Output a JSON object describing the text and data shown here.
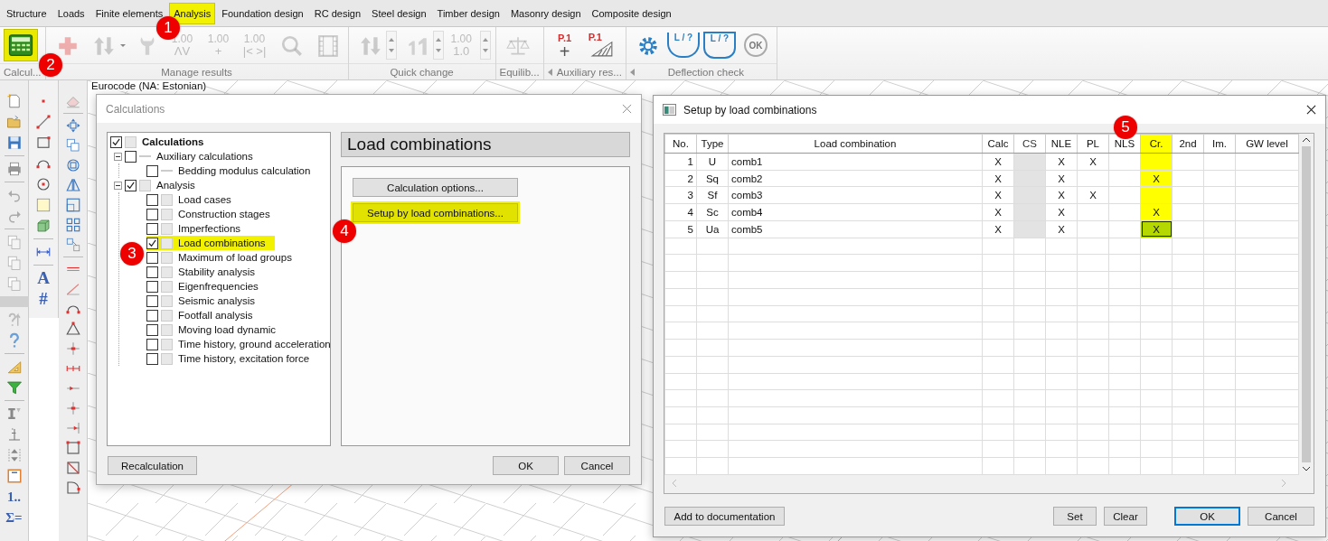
{
  "menu": [
    {
      "label": "Structure",
      "selected": false
    },
    {
      "label": "Loads",
      "selected": false
    },
    {
      "label": "Finite elements",
      "selected": false
    },
    {
      "label": "Analysis",
      "selected": true
    },
    {
      "label": "Foundation design",
      "selected": false
    },
    {
      "label": "RC design",
      "selected": false
    },
    {
      "label": "Steel design",
      "selected": false
    },
    {
      "label": "Timber design",
      "selected": false
    },
    {
      "label": "Masonry design",
      "selected": false
    },
    {
      "label": "Composite design",
      "selected": false
    }
  ],
  "ribbon": {
    "groups": [
      {
        "label": "Calcul...",
        "launcher": false,
        "items": [
          {
            "kind": "calculator",
            "disabled": false,
            "highlighted": true,
            "dropdown": false,
            "spinner": false
          }
        ]
      },
      {
        "label": "Manage results",
        "launcher": false,
        "items": [
          {
            "kind": "plus",
            "disabled": true,
            "highlighted": false,
            "dropdown": false,
            "spinner": false
          },
          {
            "kind": "arrows",
            "disabled": true,
            "highlighted": false,
            "dropdown": true,
            "spinner": false
          },
          {
            "kind": "wrench",
            "disabled": true,
            "highlighted": false,
            "dropdown": false,
            "spinner": false
          },
          {
            "kind": "text-stack",
            "lines": [
              "1.00",
              "ΛV"
            ],
            "disabled": true,
            "highlighted": false,
            "dropdown": false,
            "spinner": false
          },
          {
            "kind": "text-stack",
            "lines": [
              "1.00",
              "+"
            ],
            "disabled": true,
            "highlighted": false,
            "dropdown": false,
            "spinner": false
          },
          {
            "kind": "text-stack",
            "lines": [
              "1.00",
              "|< >|"
            ],
            "disabled": true,
            "highlighted": false,
            "dropdown": false,
            "spinner": false
          },
          {
            "kind": "magnifier",
            "disabled": true,
            "highlighted": false,
            "dropdown": false,
            "spinner": false
          },
          {
            "kind": "film",
            "disabled": true,
            "highlighted": false,
            "dropdown": false,
            "spinner": false
          }
        ]
      },
      {
        "label": "Quick change",
        "launcher": false,
        "items": [
          {
            "kind": "arrows",
            "disabled": true,
            "highlighted": false,
            "dropdown": false,
            "spinner": true
          },
          {
            "kind": "ones",
            "disabled": true,
            "highlighted": false,
            "dropdown": false,
            "spinner": true
          },
          {
            "kind": "text-stack",
            "lines": [
              "1.00",
              "1.0"
            ],
            "disabled": true,
            "highlighted": false,
            "dropdown": false,
            "spinner": true
          }
        ]
      },
      {
        "label": "Equilib...",
        "launcher": false,
        "items": [
          {
            "kind": "scales",
            "disabled": true,
            "highlighted": false,
            "dropdown": false,
            "spinner": false
          }
        ]
      },
      {
        "label": "Auxiliary res...",
        "launcher": true,
        "items": [
          {
            "kind": "point-load",
            "lines": [
              "P.1",
              "+"
            ],
            "disabled": false,
            "highlighted": false,
            "dropdown": false,
            "spinner": false
          },
          {
            "kind": "hatched-load",
            "lines": [
              "P.1"
            ],
            "disabled": false,
            "highlighted": false,
            "dropdown": false,
            "spinner": false
          }
        ]
      },
      {
        "label": "Deflection check",
        "launcher": true,
        "items": [
          {
            "kind": "gear",
            "disabled": false,
            "highlighted": false,
            "dropdown": false,
            "spinner": false
          },
          {
            "kind": "span",
            "lines": [
              "L / ?"
            ],
            "disabled": false,
            "highlighted": false,
            "dropdown": false,
            "spinner": false
          },
          {
            "kind": "span-box",
            "lines": [
              "L / ?"
            ],
            "disabled": false,
            "highlighted": false,
            "dropdown": false,
            "spinner": false
          },
          {
            "kind": "ok-circle",
            "lines": [
              "OK"
            ],
            "disabled": true,
            "highlighted": false,
            "dropdown": false,
            "spinner": false
          }
        ]
      }
    ]
  },
  "left_toolbars": [
    {
      "items": [
        {
          "kind": "new"
        },
        {
          "kind": "open"
        },
        {
          "kind": "save"
        },
        {
          "kind": "separator"
        },
        {
          "kind": "print"
        },
        {
          "kind": "separator"
        },
        {
          "kind": "undo"
        },
        {
          "kind": "redo"
        },
        {
          "kind": "separator"
        },
        {
          "kind": "copy"
        },
        {
          "kind": "copy"
        },
        {
          "kind": "copy"
        },
        {
          "kind": "gap"
        },
        {
          "kind": "help-arrow"
        },
        {
          "kind": "help"
        },
        {
          "kind": "separator"
        },
        {
          "kind": "set-square"
        },
        {
          "kind": "filter"
        },
        {
          "kind": "separator"
        },
        {
          "kind": "section"
        },
        {
          "kind": "height"
        },
        {
          "kind": "align"
        },
        {
          "kind": "frame"
        },
        {
          "kind": "glyph",
          "text": "1.."
        },
        {
          "kind": "glyph",
          "text": "Σ="
        }
      ]
    },
    {
      "items": [
        {
          "kind": "point"
        },
        {
          "kind": "line"
        },
        {
          "kind": "rect"
        },
        {
          "kind": "arc"
        },
        {
          "kind": "circle"
        },
        {
          "kind": "plate"
        },
        {
          "kind": "cube"
        },
        {
          "kind": "separator"
        },
        {
          "kind": "dimension"
        },
        {
          "kind": "separator"
        },
        {
          "kind": "glyph",
          "text": "A"
        },
        {
          "kind": "glyph",
          "text": "#"
        }
      ]
    },
    {
      "items": [
        {
          "kind": "eraser"
        },
        {
          "kind": "separator"
        },
        {
          "kind": "move"
        },
        {
          "kind": "copy-move"
        },
        {
          "kind": "rotate"
        },
        {
          "kind": "mirror"
        },
        {
          "kind": "scale"
        },
        {
          "kind": "array"
        },
        {
          "kind": "distribute"
        },
        {
          "kind": "separator"
        },
        {
          "kind": "hline"
        },
        {
          "kind": "slope"
        },
        {
          "kind": "arc"
        },
        {
          "kind": "triangle"
        },
        {
          "kind": "cross"
        },
        {
          "kind": "dimline"
        },
        {
          "kind": "arrow-point"
        },
        {
          "kind": "cross"
        },
        {
          "kind": "arrow-end"
        },
        {
          "kind": "rect-corners"
        },
        {
          "kind": "rect-diag"
        },
        {
          "kind": "rect-arc"
        }
      ]
    }
  ],
  "canvas": {
    "caption": "Eurocode (NA: Estonian)"
  },
  "calculations_dialog": {
    "title": "Calculations",
    "tree": [
      {
        "label": "Calculations",
        "checked": true,
        "selected": false,
        "kind": "box",
        "children": [
          {
            "label": "Auxiliary calculations",
            "checked": false,
            "selected": false,
            "kind": "dash",
            "expanded": true,
            "children": [
              {
                "label": "Bedding modulus calculation",
                "checked": false,
                "selected": false,
                "kind": "dash"
              }
            ]
          },
          {
            "label": "Analysis",
            "checked": true,
            "selected": false,
            "kind": "box",
            "expanded": true,
            "children": [
              {
                "label": "Load cases",
                "checked": false,
                "selected": false,
                "kind": "box"
              },
              {
                "label": "Construction stages",
                "checked": false,
                "selected": false,
                "kind": "box"
              },
              {
                "label": "Imperfections",
                "checked": false,
                "selected": false,
                "kind": "box"
              },
              {
                "label": "Load combinations",
                "checked": true,
                "selected": true,
                "kind": "box"
              },
              {
                "label": "Maximum of load groups",
                "checked": false,
                "selected": false,
                "kind": "box"
              },
              {
                "label": "Stability analysis",
                "checked": false,
                "selected": false,
                "kind": "box"
              },
              {
                "label": "Eigenfrequencies",
                "checked": false,
                "selected": false,
                "kind": "box"
              },
              {
                "label": "Seismic analysis",
                "checked": false,
                "selected": false,
                "kind": "box"
              },
              {
                "label": "Footfall analysis",
                "checked": false,
                "selected": false,
                "kind": "box"
              },
              {
                "label": "Moving load dynamic",
                "checked": false,
                "selected": false,
                "kind": "box"
              },
              {
                "label": "Time history, ground acceleration",
                "checked": false,
                "selected": false,
                "kind": "box"
              },
              {
                "label": "Time history, excitation force",
                "checked": false,
                "selected": false,
                "kind": "box"
              }
            ]
          }
        ]
      }
    ],
    "heading": "Load combinations",
    "panel_buttons": [
      {
        "label": "Calculation options...",
        "highlighted": false
      },
      {
        "label": "Setup by load combinations...",
        "highlighted": true
      }
    ],
    "buttons": [
      {
        "label": "Recalculation",
        "kind": "left"
      },
      {
        "label": "OK",
        "kind": "right"
      },
      {
        "label": "Cancel",
        "kind": "right"
      }
    ]
  },
  "setup_dialog": {
    "title": "Setup by load combinations",
    "columns": [
      {
        "label": "No.",
        "kind": "number",
        "disabled": false,
        "highlighted": false
      },
      {
        "label": "Type",
        "kind": "flag",
        "disabled": false,
        "highlighted": false
      },
      {
        "label": "Load combination",
        "kind": "text",
        "disabled": false,
        "highlighted": false
      },
      {
        "label": "Calc",
        "kind": "flag",
        "disabled": false,
        "highlighted": false
      },
      {
        "label": "CS",
        "kind": "flag",
        "disabled": true,
        "highlighted": false
      },
      {
        "label": "NLE",
        "kind": "flag",
        "disabled": false,
        "highlighted": false
      },
      {
        "label": "PL",
        "kind": "flag",
        "disabled": false,
        "highlighted": false
      },
      {
        "label": "NLS",
        "kind": "flag",
        "disabled": false,
        "highlighted": false
      },
      {
        "label": "Cr.",
        "kind": "flag",
        "disabled": false,
        "highlighted": true
      },
      {
        "label": "2nd",
        "kind": "flag",
        "disabled": false,
        "highlighted": false
      },
      {
        "label": "Im.",
        "kind": "flag",
        "disabled": false,
        "highlighted": false
      },
      {
        "label": "GW level",
        "kind": "wide",
        "disabled": false,
        "highlighted": false
      }
    ],
    "rows": [
      {
        "selected": false,
        "cells": [
          "1",
          "U",
          "comb1",
          "X",
          null,
          "X",
          "X",
          null,
          null,
          null,
          null,
          null
        ]
      },
      {
        "selected": false,
        "cells": [
          "2",
          "Sq",
          "comb2",
          "X",
          null,
          "X",
          null,
          null,
          "X",
          null,
          null,
          null
        ]
      },
      {
        "selected": false,
        "cells": [
          "3",
          "Sf",
          "comb3",
          "X",
          null,
          "X",
          "X",
          null,
          null,
          null,
          null,
          null
        ]
      },
      {
        "selected": false,
        "cells": [
          "4",
          "Sc",
          "comb4",
          "X",
          null,
          "X",
          null,
          null,
          "X",
          null,
          null,
          null
        ]
      },
      {
        "selected": true,
        "cells": [
          "5",
          "Ua",
          "comb5",
          "X",
          null,
          "X",
          null,
          null,
          "X",
          null,
          null,
          null
        ]
      }
    ],
    "buttons": [
      {
        "label": "Add to documentation",
        "kind": "left"
      },
      {
        "label": "Set",
        "kind": "middle"
      },
      {
        "label": "Clear",
        "kind": "middle"
      },
      {
        "label": "OK",
        "kind": "default"
      },
      {
        "label": "Cancel",
        "kind": "plain"
      }
    ]
  },
  "callouts": [
    {
      "label": "1"
    },
    {
      "label": "2"
    },
    {
      "label": "3"
    },
    {
      "label": "4"
    },
    {
      "label": "5"
    }
  ]
}
